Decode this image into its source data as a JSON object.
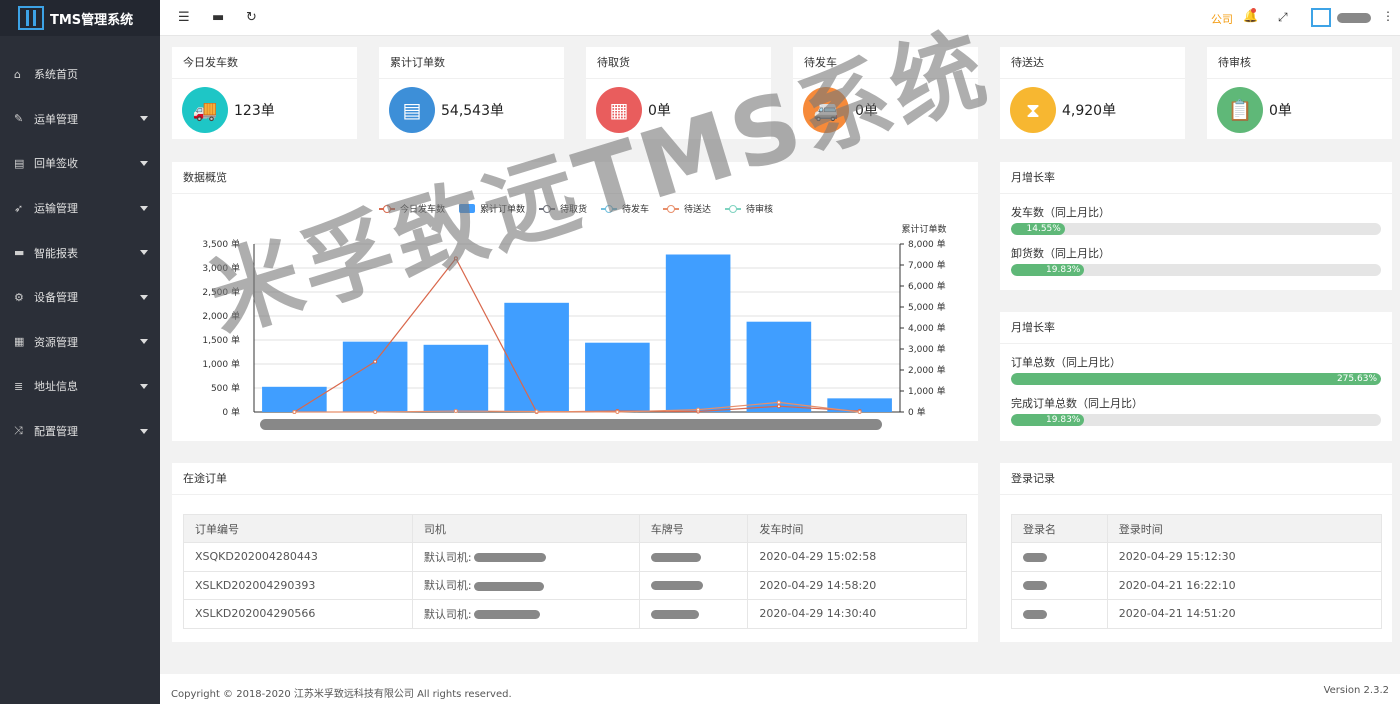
{
  "app": {
    "title": "TMS管理系统"
  },
  "sidebar": {
    "items": [
      {
        "icon": "⌂",
        "label": "系统首页",
        "has_caret": false
      },
      {
        "icon": "✎",
        "label": "运单管理",
        "has_caret": true
      },
      {
        "icon": "▤",
        "label": "回单签收",
        "has_caret": true
      },
      {
        "icon": "➶",
        "label": "运输管理",
        "has_caret": true
      },
      {
        "icon": "▬",
        "label": "智能报表",
        "has_caret": true
      },
      {
        "icon": "⚙",
        "label": "设备管理",
        "has_caret": true
      },
      {
        "icon": "▦",
        "label": "资源管理",
        "has_caret": true
      },
      {
        "icon": "≣",
        "label": "地址信息",
        "has_caret": true
      },
      {
        "icon": "⤨",
        "label": "配置管理",
        "has_caret": true
      }
    ]
  },
  "topbar": {
    "menu_icon": "☰",
    "monitor_icon": "▬",
    "refresh_icon": "↻",
    "company": "公司",
    "bell_icon": "🔔",
    "expand_icon": "⤢",
    "more_icon": "⋮"
  },
  "stats": [
    {
      "title": "今日发车数",
      "value": "123单",
      "color": "#1ec6c6",
      "icon": "truck-icon",
      "glyph": "🚚"
    },
    {
      "title": "累计订单数",
      "value": "54,543单",
      "color": "#3d8fd8",
      "icon": "calendar-icon",
      "glyph": "▤"
    },
    {
      "title": "待取货",
      "value": "0单",
      "color": "#e95d5d",
      "icon": "layout-icon",
      "glyph": "▦"
    },
    {
      "title": "待发车",
      "value": "0单",
      "color": "#f68a3a",
      "icon": "van-icon",
      "glyph": "🚐"
    },
    {
      "title": "待送达",
      "value": "4,920单",
      "color": "#f7b731",
      "icon": "hourglass-icon",
      "glyph": "⧗"
    },
    {
      "title": "待审核",
      "value": "0单",
      "color": "#5fb878",
      "icon": "clipboard-icon",
      "glyph": "📋"
    }
  ],
  "overview": {
    "title": "数据概览"
  },
  "chart_data": {
    "type": "bar",
    "legend": [
      "今日发车数",
      "累计订单数",
      "待取货",
      "待发车",
      "待送达",
      "待审核"
    ],
    "legend_colors": [
      "#d9684c",
      "#409eff",
      "#6e7079",
      "#73c0de",
      "#e88f6b",
      "#7fd3c0"
    ],
    "y_left": {
      "ticks": [
        "3,500 单",
        "3,000 单",
        "2,500 单",
        "2,000 单",
        "1,500 单",
        "1,000 单",
        "500 单",
        "0 单"
      ],
      "min": 0,
      "max": 3500
    },
    "y_right": {
      "label": "累计订单数",
      "ticks": [
        "8,000 单",
        "7,000 单",
        "6,000 单",
        "5,000 单",
        "4,000 单",
        "3,000 单",
        "2,000 单",
        "1,000 单",
        "0 单"
      ],
      "min": 0,
      "max": 8000
    },
    "bar_series": {
      "name": "累计订单数",
      "values": [
        1200,
        3350,
        3200,
        5200,
        3300,
        7500,
        4300,
        650
      ]
    },
    "line_series": {
      "name": "今日发车数",
      "values": [
        0,
        1050,
        3200,
        0,
        20,
        10,
        120,
        20
      ]
    },
    "line_series_2": {
      "name": "待送达",
      "values": [
        0,
        0,
        20,
        10,
        0,
        50,
        200,
        0
      ]
    }
  },
  "growth1": {
    "title": "月增长率",
    "items": [
      {
        "label": "发车数（同上月比）",
        "pct": 14.55,
        "text": "14.55%"
      },
      {
        "label": "卸货数（同上月比）",
        "pct": 19.83,
        "text": "19.83%"
      }
    ]
  },
  "growth2": {
    "title": "月增长率",
    "items": [
      {
        "label": "订单总数（同上月比）",
        "pct": 100,
        "text": "275.63%"
      },
      {
        "label": "完成订单总数（同上月比）",
        "pct": 19.83,
        "text": "19.83%"
      }
    ]
  },
  "transit": {
    "title": "在途订单",
    "headers": [
      "订单编号",
      "司机",
      "车牌号",
      "发车时间"
    ],
    "rows": [
      {
        "order": "XSQKD202004280443",
        "driver": "默认司机:",
        "time": "2020-04-29 15:02:58"
      },
      {
        "order": "XSLKD202004290393",
        "driver": "默认司机:",
        "time": "2020-04-29 14:58:20"
      },
      {
        "order": "XSLKD202004290566",
        "driver": "默认司机:",
        "time": "2020-04-29 14:30:40"
      }
    ]
  },
  "login": {
    "title": "登录记录",
    "headers": [
      "登录名",
      "登录时间"
    ],
    "rows": [
      {
        "time": "2020-04-29 15:12:30"
      },
      {
        "time": "2020-04-21 16:22:10"
      },
      {
        "time": "2020-04-21 14:51:20"
      }
    ]
  },
  "footer": {
    "copyright": "Copyright © 2018-2020 江苏米孚致远科技有限公司 All rights reserved.",
    "version": "Version 2.3.2"
  },
  "watermark": "米孚致远TMS系统"
}
